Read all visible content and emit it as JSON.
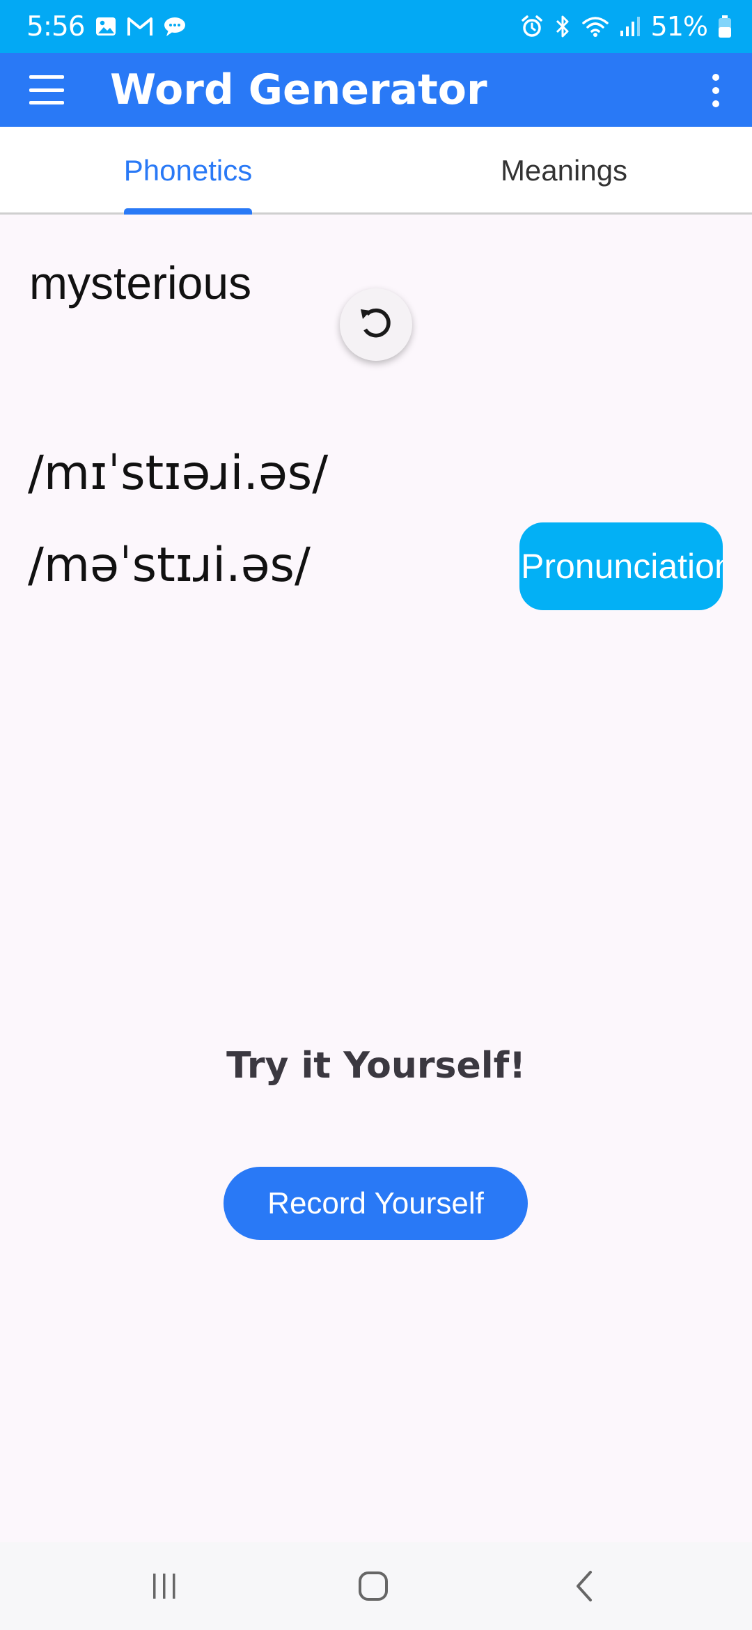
{
  "status_bar": {
    "time": "5:56",
    "battery": "51%",
    "background_color": "#03a9f4",
    "icons": [
      "gallery-icon",
      "gmail-icon",
      "chat-icon",
      "alarm-icon",
      "bluetooth-icon",
      "wifi-icon",
      "signal-icon",
      "battery-icon"
    ]
  },
  "app_bar": {
    "title": "Word Generator",
    "background_color": "#2979f6",
    "menu_icon": "hamburger-menu-icon",
    "overflow_icon": "more-vert-icon"
  },
  "tabs": [
    {
      "label": "Phonetics",
      "selected": true
    },
    {
      "label": "Meanings",
      "selected": false
    }
  ],
  "main": {
    "word": "mysterious",
    "refresh_icon": "refresh-icon",
    "phonetics": [
      "/mɪˈstɪəɹi.əs/",
      "/məˈstɪɹi.əs/"
    ],
    "pronunciation_label": "Pronunciation",
    "pronunciation_color": "#03b0f5",
    "try_heading": "Try it Yourself!",
    "record_label": "Record Yourself",
    "accent_color": "#2979f6"
  },
  "nav_bar": {
    "icons": [
      "recent-apps-icon",
      "home-icon",
      "back-icon"
    ]
  }
}
